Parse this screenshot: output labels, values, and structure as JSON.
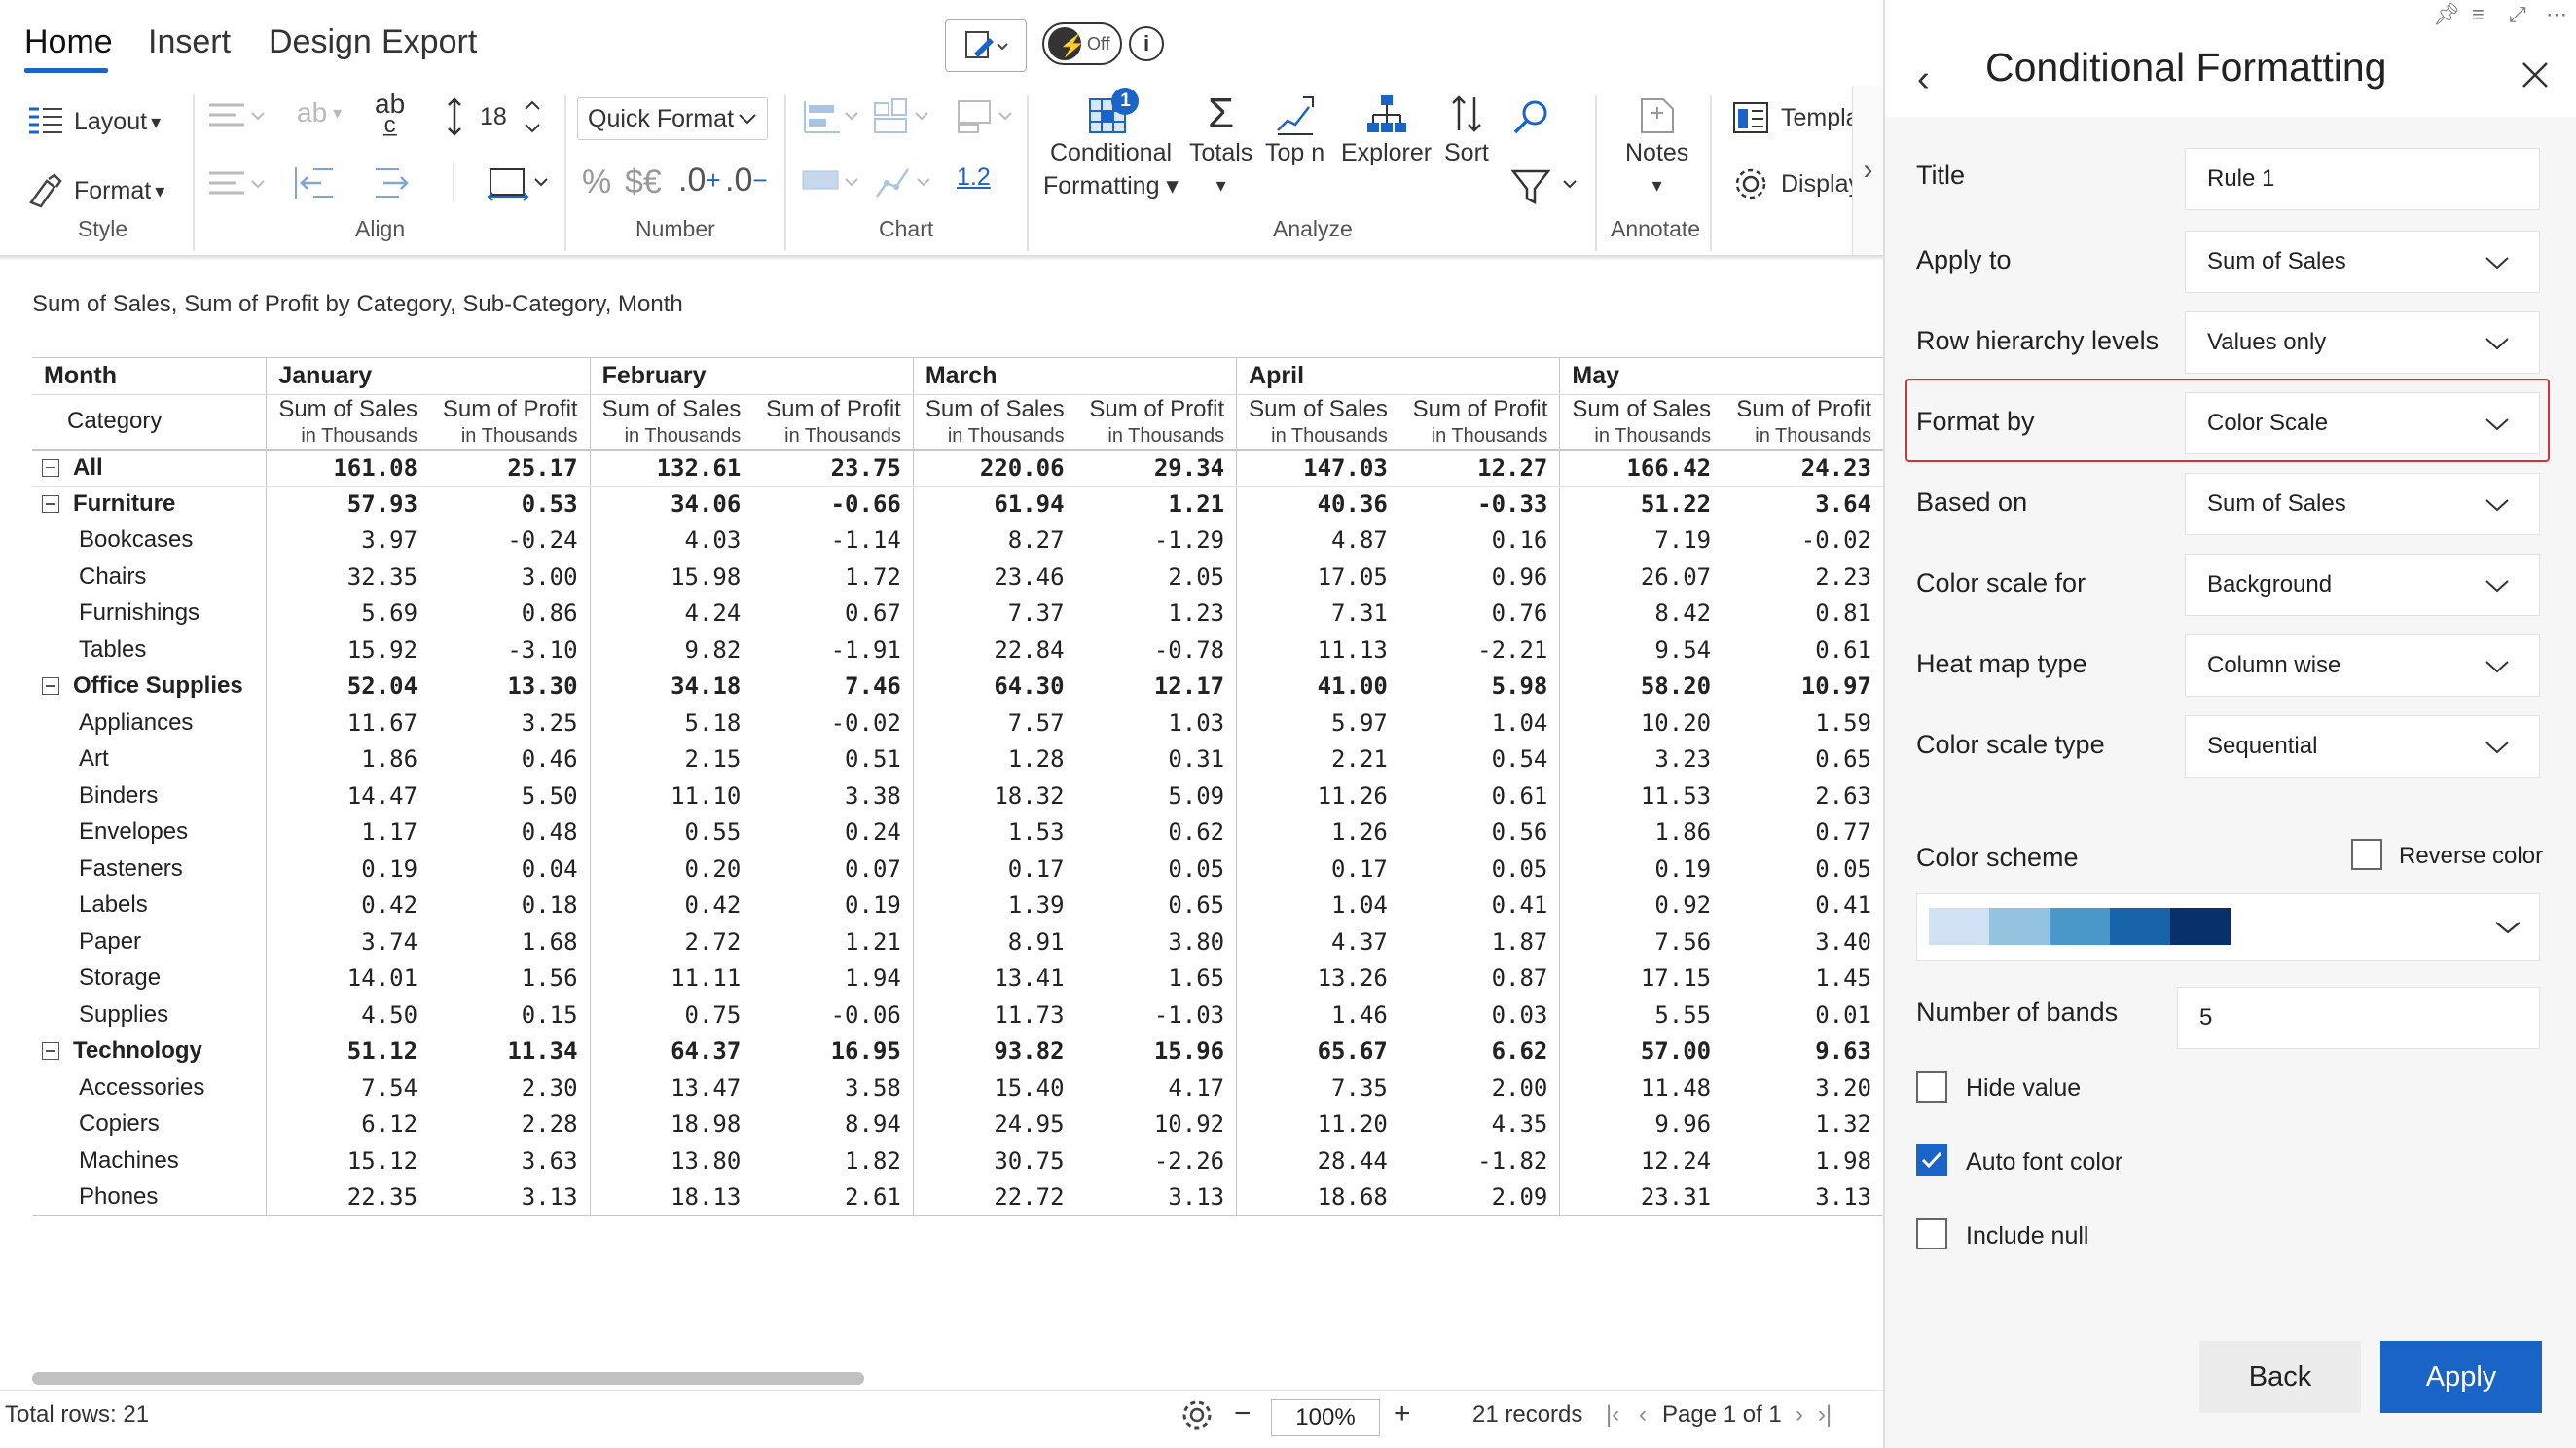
{
  "menu": {
    "tabs": [
      "Home",
      "Insert",
      "Design",
      "Export"
    ]
  },
  "ribbon": {
    "layout": "Layout",
    "format": "Format",
    "style_group": "Style",
    "align_group": "Align",
    "font_size": "18",
    "quick_format": "Quick Format",
    "number_group": "Number",
    "currency_symbols": "$€",
    "decimal_inc": ".0",
    "decimal_dec": ".0",
    "percent": "%",
    "scale_value": "1.2",
    "chart_group": "Chart",
    "toggle_state": "Off",
    "conditional_formatting_line1": "Conditional",
    "conditional_formatting_line2": "Formatting",
    "cf_badge": "1",
    "totals": "Totals",
    "topn": "Top n",
    "explorer": "Explorer",
    "sort": "Sort",
    "analyze_group": "Analyze",
    "notes": "Notes",
    "annotate_group": "Annotate",
    "template": "Templa",
    "display": "Display"
  },
  "table": {
    "subtitle": "Sum of Sales, Sum of Profit by Category, Sub-Category, Month",
    "month_header": "Month",
    "category_header": "Category",
    "months": [
      "January",
      "February",
      "March",
      "April",
      "May"
    ],
    "measure_sales": "Sum of Sales",
    "measure_profit": "Sum of Profit",
    "measure_unit": "in Thousands",
    "rows": [
      {
        "label": "All",
        "level": 0,
        "values": [
          "161.08",
          "25.17",
          "132.61",
          "23.75",
          "220.06",
          "29.34",
          "147.03",
          "12.27",
          "166.42",
          "24.23"
        ]
      },
      {
        "label": "Furniture",
        "level": 1,
        "values": [
          "57.93",
          "0.53",
          "34.06",
          "-0.66",
          "61.94",
          "1.21",
          "40.36",
          "-0.33",
          "51.22",
          "3.64"
        ]
      },
      {
        "label": "Bookcases",
        "level": 2,
        "values": [
          "3.97",
          "-0.24",
          "4.03",
          "-1.14",
          "8.27",
          "-1.29",
          "4.87",
          "0.16",
          "7.19",
          "-0.02"
        ]
      },
      {
        "label": "Chairs",
        "level": 2,
        "values": [
          "32.35",
          "3.00",
          "15.98",
          "1.72",
          "23.46",
          "2.05",
          "17.05",
          "0.96",
          "26.07",
          "2.23"
        ]
      },
      {
        "label": "Furnishings",
        "level": 2,
        "values": [
          "5.69",
          "0.86",
          "4.24",
          "0.67",
          "7.37",
          "1.23",
          "7.31",
          "0.76",
          "8.42",
          "0.81"
        ]
      },
      {
        "label": "Tables",
        "level": 2,
        "values": [
          "15.92",
          "-3.10",
          "9.82",
          "-1.91",
          "22.84",
          "-0.78",
          "11.13",
          "-2.21",
          "9.54",
          "0.61"
        ]
      },
      {
        "label": "Office Supplies",
        "level": 1,
        "values": [
          "52.04",
          "13.30",
          "34.18",
          "7.46",
          "64.30",
          "12.17",
          "41.00",
          "5.98",
          "58.20",
          "10.97"
        ]
      },
      {
        "label": "Appliances",
        "level": 2,
        "values": [
          "11.67",
          "3.25",
          "5.18",
          "-0.02",
          "7.57",
          "1.03",
          "5.97",
          "1.04",
          "10.20",
          "1.59"
        ]
      },
      {
        "label": "Art",
        "level": 2,
        "values": [
          "1.86",
          "0.46",
          "2.15",
          "0.51",
          "1.28",
          "0.31",
          "2.21",
          "0.54",
          "3.23",
          "0.65"
        ]
      },
      {
        "label": "Binders",
        "level": 2,
        "values": [
          "14.47",
          "5.50",
          "11.10",
          "3.38",
          "18.32",
          "5.09",
          "11.26",
          "0.61",
          "11.53",
          "2.63"
        ]
      },
      {
        "label": "Envelopes",
        "level": 2,
        "values": [
          "1.17",
          "0.48",
          "0.55",
          "0.24",
          "1.53",
          "0.62",
          "1.26",
          "0.56",
          "1.86",
          "0.77"
        ]
      },
      {
        "label": "Fasteners",
        "level": 2,
        "values": [
          "0.19",
          "0.04",
          "0.20",
          "0.07",
          "0.17",
          "0.05",
          "0.17",
          "0.05",
          "0.19",
          "0.05"
        ]
      },
      {
        "label": "Labels",
        "level": 2,
        "values": [
          "0.42",
          "0.18",
          "0.42",
          "0.19",
          "1.39",
          "0.65",
          "1.04",
          "0.41",
          "0.92",
          "0.41"
        ]
      },
      {
        "label": "Paper",
        "level": 2,
        "values": [
          "3.74",
          "1.68",
          "2.72",
          "1.21",
          "8.91",
          "3.80",
          "4.37",
          "1.87",
          "7.56",
          "3.40"
        ]
      },
      {
        "label": "Storage",
        "level": 2,
        "values": [
          "14.01",
          "1.56",
          "11.11",
          "1.94",
          "13.41",
          "1.65",
          "13.26",
          "0.87",
          "17.15",
          "1.45"
        ]
      },
      {
        "label": "Supplies",
        "level": 2,
        "values": [
          "4.50",
          "0.15",
          "0.75",
          "-0.06",
          "11.73",
          "-1.03",
          "1.46",
          "0.03",
          "5.55",
          "0.01"
        ]
      },
      {
        "label": "Technology",
        "level": 1,
        "values": [
          "51.12",
          "11.34",
          "64.37",
          "16.95",
          "93.82",
          "15.96",
          "65.67",
          "6.62",
          "57.00",
          "9.63"
        ]
      },
      {
        "label": "Accessories",
        "level": 2,
        "values": [
          "7.54",
          "2.30",
          "13.47",
          "3.58",
          "15.40",
          "4.17",
          "7.35",
          "2.00",
          "11.48",
          "3.20"
        ]
      },
      {
        "label": "Copiers",
        "level": 2,
        "values": [
          "6.12",
          "2.28",
          "18.98",
          "8.94",
          "24.95",
          "10.92",
          "11.20",
          "4.35",
          "9.96",
          "1.32"
        ]
      },
      {
        "label": "Machines",
        "level": 2,
        "values": [
          "15.12",
          "3.63",
          "13.80",
          "1.82",
          "30.75",
          "-2.26",
          "28.44",
          "-1.82",
          "12.24",
          "1.98"
        ]
      },
      {
        "label": "Phones",
        "level": 2,
        "values": [
          "22.35",
          "3.13",
          "18.13",
          "2.61",
          "22.72",
          "3.13",
          "18.68",
          "2.09",
          "23.31",
          "3.13"
        ]
      }
    ]
  },
  "footer": {
    "total_rows": "Total rows: 21",
    "zoom": "100%",
    "records": "21 records",
    "page": "Page 1 of 1"
  },
  "panel": {
    "title": "Conditional Formatting",
    "fields": {
      "title_label": "Title",
      "title_value": "Rule 1",
      "apply_label": "Apply to",
      "apply_value": "Sum of Sales",
      "row_label": "Row hierarchy levels",
      "row_value": "Values only",
      "format_label": "Format by",
      "format_value": "Color Scale",
      "based_label": "Based on",
      "based_value": "Sum of Sales",
      "csfor_label": "Color scale for",
      "csfor_value": "Background",
      "heat_label": "Heat map type",
      "heat_value": "Column wise",
      "cstype_label": "Color scale type",
      "cstype_value": "Sequential"
    },
    "color_scheme_label": "Color scheme",
    "reverse_color": "Reverse color",
    "scheme_colors": [
      "#cfe1f2",
      "#93c3df",
      "#4a98c9",
      "#1764ab",
      "#08306b"
    ],
    "bands_label": "Number of bands",
    "bands_value": "5",
    "hide_value": "Hide value",
    "auto_font": "Auto font color",
    "include_null": "Include null",
    "back": "Back",
    "apply": "Apply"
  }
}
